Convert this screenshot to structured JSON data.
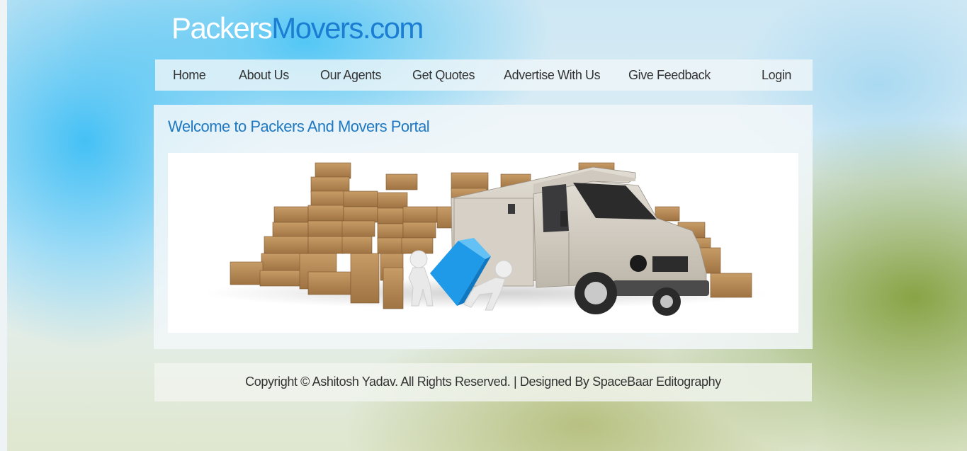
{
  "site": {
    "logo_part1": "Packers",
    "logo_part2": "Movers.com"
  },
  "nav": {
    "items": [
      {
        "label": "Home"
      },
      {
        "label": "About Us"
      },
      {
        "label": "Our Agents"
      },
      {
        "label": "Get Quotes"
      },
      {
        "label": "Advertise With Us"
      },
      {
        "label": "Give Feedback"
      },
      {
        "label": "Login"
      }
    ]
  },
  "main": {
    "welcome": "Welcome to Packers And Movers Portal",
    "banner_image": "moving-truck-with-boxes-and-figures-carrying-box"
  },
  "footer": {
    "text": "Copyright © Ashitosh Yadav. All Rights Reserved. | Designed By SpaceBaar Editography"
  },
  "colors": {
    "logo_accent": "#1b7ed3",
    "heading": "#1f78c1",
    "cube": "#1f9ae8"
  }
}
